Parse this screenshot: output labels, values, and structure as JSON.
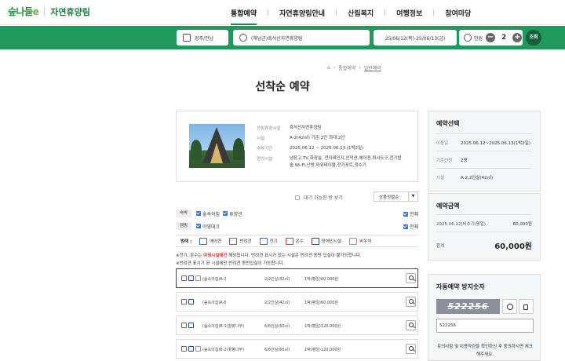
{
  "header": {
    "logo_text": "숲나들",
    "logo_accent": "e",
    "logo_sub": "자연휴양림",
    "nav": [
      {
        "label": "통합예약",
        "active": true
      },
      {
        "label": "자연휴양림안내",
        "active": false
      },
      {
        "label": "산림복지",
        "active": false
      },
      {
        "label": "여행정보",
        "active": false
      },
      {
        "label": "참여마당",
        "active": false
      }
    ]
  },
  "searchbar": {
    "region": "광주/전남",
    "forest": "(해남군)흑석산자연휴양림",
    "dates": "25/06/12(목)-25/06/13(금)",
    "people_label": "인원",
    "people_count": "2",
    "search_label": "조회",
    "minus": "−",
    "plus": "+"
  },
  "breadcrumb": {
    "items": [
      "통합예약",
      "일반예약"
    ]
  },
  "page_title": "선착순 예약",
  "info": {
    "rows": [
      {
        "k": "산림휴양시설",
        "v": "흑석산자연휴양림"
      },
      {
        "k": "시설",
        "v": "A-2(42㎡) 기준:2인 최대:2인"
      },
      {
        "k": "숙박기간",
        "v": "2025.06.12 ~ 2025.06.13 (1박2일)"
      },
      {
        "k": "편의시설",
        "v": "냉장고,TV,화장실, 전자레인지,인덕션,에어컨,취사도구,전기밥솥,Wi-Fi,난방,마위테이블,전기포트,정수기"
      }
    ]
  },
  "filters": {
    "available_only": "대기 가능한 방 보기",
    "sort": "상품정렬순",
    "sort_arrow": "▼",
    "lodging_label": "숙박",
    "lodging_opts": [
      "숲속의집",
      "휴양관"
    ],
    "camp_label": "캠핑",
    "camp_opts": [
      "야영데크"
    ],
    "all": "전체"
  },
  "legend": {
    "title": "범례 :",
    "items": [
      "에어컨",
      "반려견",
      "전기",
      "온수",
      "장애인시설",
      "바우처"
    ]
  },
  "notices": {
    "line1_pre": "※전기, 온수는 ",
    "line1_red": "야영시설에만",
    "line1_post": " 해당됩니다. 반려견 표시가 없는 시설은 반려견 동반 입실이 불가능합니다.",
    "line2": "※반려견 표시가 된 시설에만 반려견 동반입실이 가능합니다."
  },
  "rooms": [
    {
      "name": "(숲속의집)A-2",
      "cap": "2/2인실(42㎡)",
      "price": "1박(평일)60,000원"
    },
    {
      "name": "(숲속의집)A-6",
      "cap": "2/2인실(42㎡)",
      "price": "1박(평일)60,000원"
    },
    {
      "name": "(숲속의집)B-1(잘랑나무)",
      "cap": "6/6인실(60㎡)",
      "price": "1박(평일)120,000원"
    },
    {
      "name": "(숲속의집)B-2(꽃봉나무)",
      "cap": "6/6인실(60㎡)",
      "price": "1박(평일)120,000원"
    }
  ],
  "summary": {
    "title": "예약선택",
    "rows": [
      {
        "k": "이용일",
        "v": "2025.06.12~2025.06.13(1박2일)"
      },
      {
        "k": "기준인원",
        "v": "2명"
      },
      {
        "k": "시설",
        "v": "A-2,2인실(42㎡)"
      }
    ]
  },
  "amount": {
    "title": "예약금액",
    "line_label": "2025.06.12(비수기/평일)",
    "line_value": "60,000원",
    "total_label": "합계",
    "total_value": "60,000원"
  },
  "captcha": {
    "title": "자동예약 방지숫자",
    "image_text": "522256",
    "input_value": "522256",
    "note": "유의사항 및 이용약관을 확인하신 후 동의하시면 체크해주세요."
  }
}
